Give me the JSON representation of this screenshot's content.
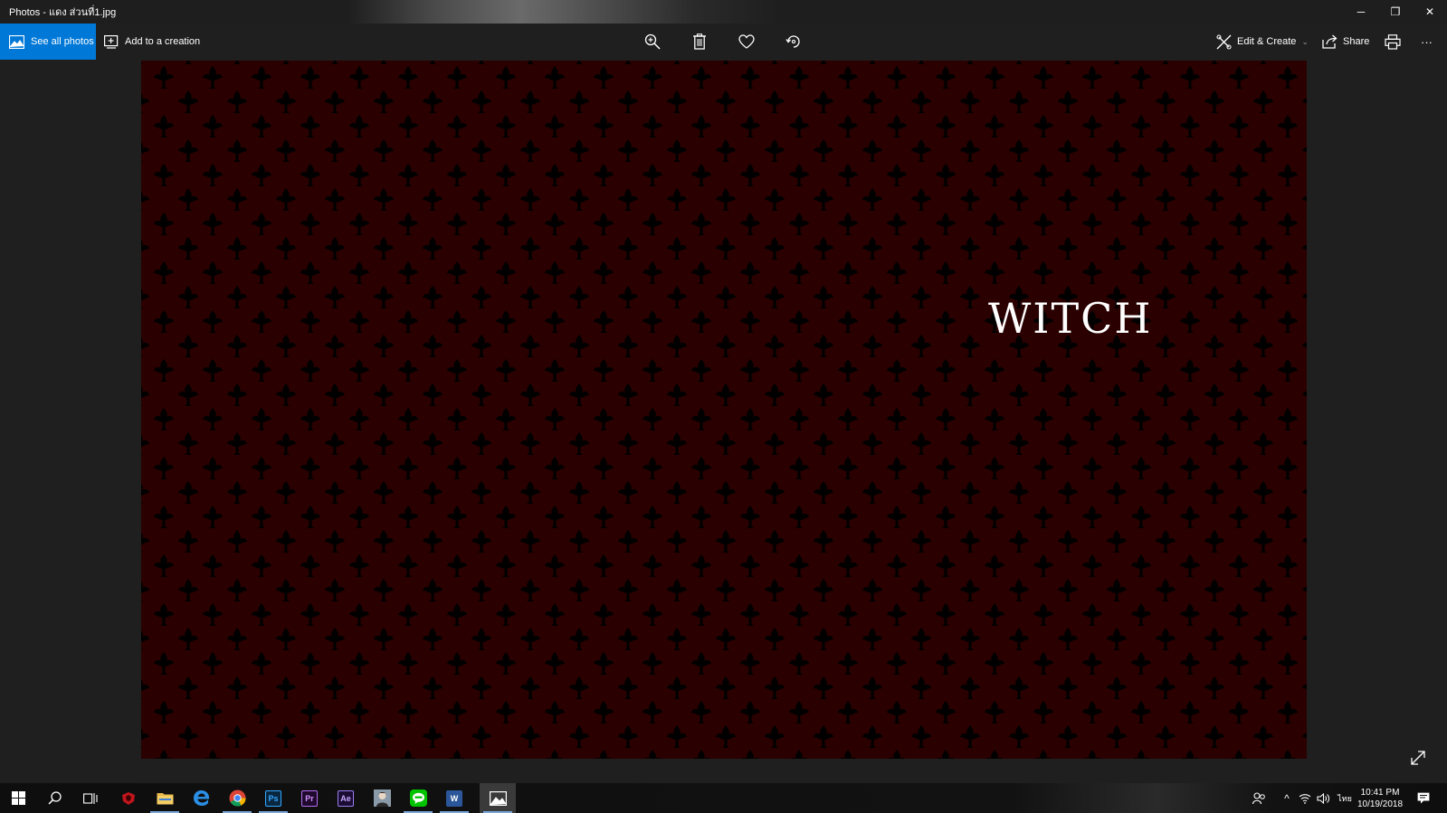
{
  "window": {
    "title": "Photos - แดง ส่วนที่1.jpg",
    "minimize_symbol": "─",
    "restore_symbol": "❐",
    "close_symbol": "✕"
  },
  "toolbar": {
    "see_all_photos": "See all photos",
    "add_to_creation": "Add to a creation",
    "edit_create": "Edit & Create",
    "edit_create_chevron": "⌄",
    "share": "Share",
    "more": "···",
    "icons": [
      "zoom-in-icon",
      "delete-icon",
      "heart-icon",
      "rotate-icon",
      "print-icon"
    ]
  },
  "photo": {
    "text": "WITCH",
    "background_color": "#2a0000",
    "pattern_color": "#000000"
  },
  "taskbar": {
    "apps": [
      "start-icon",
      "search-icon",
      "task-view-icon",
      "game-icon",
      "file-explorer-icon",
      "edge-icon",
      "chrome-icon",
      "photoshop-icon",
      "premiere-icon",
      "after-effects-icon",
      "avatar-app-icon",
      "line-icon",
      "word-icon",
      "photos-icon"
    ],
    "tile_labels": {
      "photoshop": "Ps",
      "premiere": "Pr",
      "after_effects": "Ae",
      "word": "W"
    },
    "tray": {
      "language": "ไทย",
      "chevron": "^"
    },
    "clock": {
      "time": "10:41 PM",
      "date": "10/19/2018"
    }
  },
  "colors": {
    "accent": "#0078d7",
    "chrome": "#1f1f1f",
    "taskbar": "#101010"
  }
}
